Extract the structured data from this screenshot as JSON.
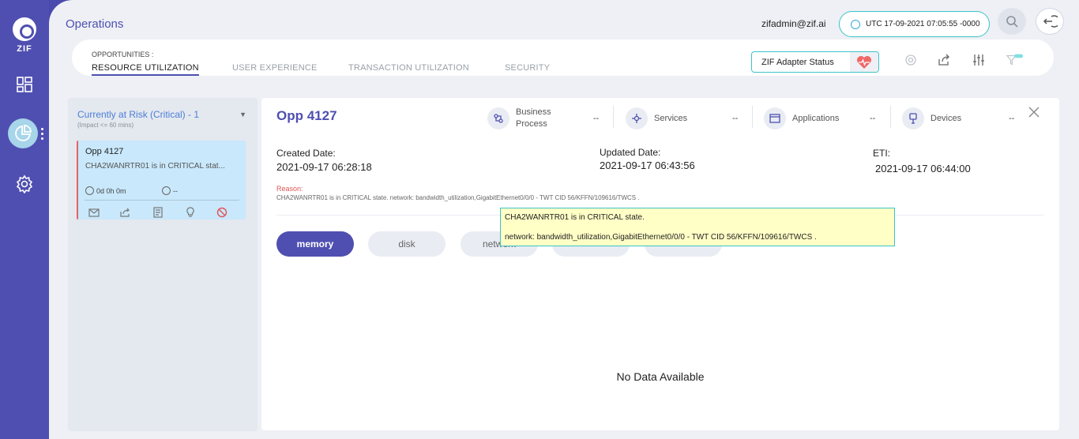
{
  "app": {
    "logo_text": "ZIF"
  },
  "header": {
    "title": "Operations",
    "user_email": "zifadmin@zif.ai",
    "clock": "UTC 17-09-2021 07:05:55 -0000"
  },
  "tabs": {
    "label": "OPPORTUNITIES :",
    "items": [
      {
        "label": "RESOURCE UTILIZATION",
        "active": true
      },
      {
        "label": "USER EXPERIENCE",
        "active": false
      },
      {
        "label": "TRANSACTION UTILIZATION",
        "active": false
      },
      {
        "label": "SECURITY",
        "active": false
      }
    ],
    "adapter_status_label": "ZIF Adapter Status"
  },
  "left_panel": {
    "title": "Currently at Risk (Critical) - 1",
    "subtitle": "(Impact <= 60 mins)",
    "card": {
      "title": "Opp 4127",
      "description": "CHA2WANRTR01 is in CRITICAL stat...",
      "time_elapsed": "0d 0h 0m",
      "time_remaining": "--"
    }
  },
  "detail": {
    "title": "Opp 4127",
    "stats": [
      {
        "label": "Business Process",
        "value": "--",
        "icon": "business-process-icon"
      },
      {
        "label": "Services",
        "value": "--",
        "icon": "services-icon"
      },
      {
        "label": "Applications",
        "value": "--",
        "icon": "applications-icon"
      },
      {
        "label": "Devices",
        "value": "--",
        "icon": "devices-icon"
      }
    ],
    "created_label": "Created Date:",
    "created_value": "2021-09-17 06:28:18",
    "updated_label": "Updated Date:",
    "updated_value": "2021-09-17 06:43:56",
    "eti_label": "ETI:",
    "eti_value": "2021-09-17 06:44:00",
    "reason_label": "Reason:",
    "reason_value": "CHA2WANRTR01 is in CRITICAL state. network: bandwidth_utilization,GigabitEthernet0/0/0 - TWT CID 56/KFFN/109616/TWCS .",
    "tooltip_line1": "CHA2WANRTR01 is in CRITICAL state.",
    "tooltip_line2": "network: bandwidth_utilization,GigabitEthernet0/0/0 - TWT CID 56/KFFN/109616/TWCS .",
    "metric_tabs": [
      "memory",
      "disk",
      "network",
      "",
      ""
    ],
    "empty_text": "No Data Available"
  },
  "colors": {
    "accent": "#4f4fb1",
    "teal": "#3cc3c8",
    "critical": "#e25555"
  }
}
